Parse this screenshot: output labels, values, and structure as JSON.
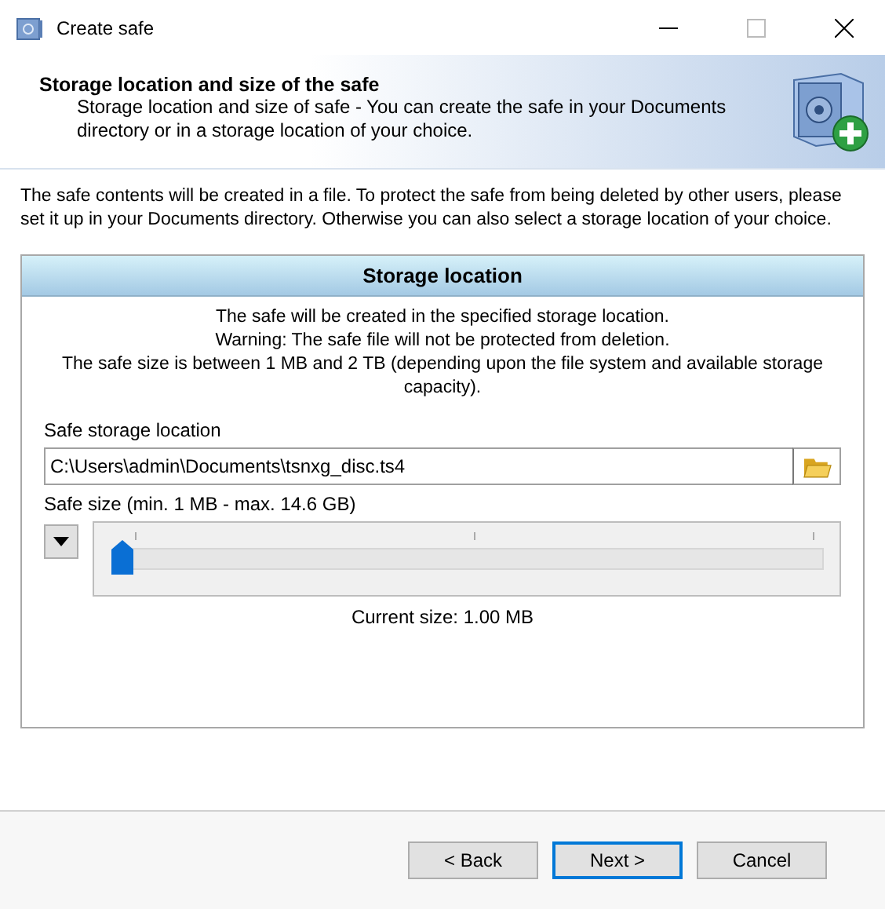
{
  "window": {
    "title": "Create safe"
  },
  "header": {
    "title": "Storage location and size of the safe",
    "subtitle": "Storage location and size of safe - You can create the safe in your Documents directory or in a storage location of your choice."
  },
  "intro": "The safe contents will be created in a file. To protect the safe from being deleted by other users, please set it up in your Documents directory. Otherwise you can also select a storage location of your choice.",
  "group": {
    "title": "Storage location",
    "notes": [
      "The safe will be created in the specified storage location.",
      "Warning: The safe file will not be protected from deletion.",
      "The safe size is between 1 MB and 2 TB (depending upon the file system and available storage capacity)."
    ],
    "location_label": "Safe storage location",
    "location_value": "C:\\Users\\admin\\Documents\\tsnxg_disc.ts4",
    "size_label": "Safe size (min. 1 MB - max. 14.6 GB)",
    "size_slider": {
      "level": 0
    },
    "current_size": "Current size: 1.00 MB"
  },
  "buttons": [
    {
      "label": "< Back",
      "default": false
    },
    {
      "label": "Next >",
      "default": true
    },
    {
      "label": "Cancel",
      "default": false
    }
  ]
}
